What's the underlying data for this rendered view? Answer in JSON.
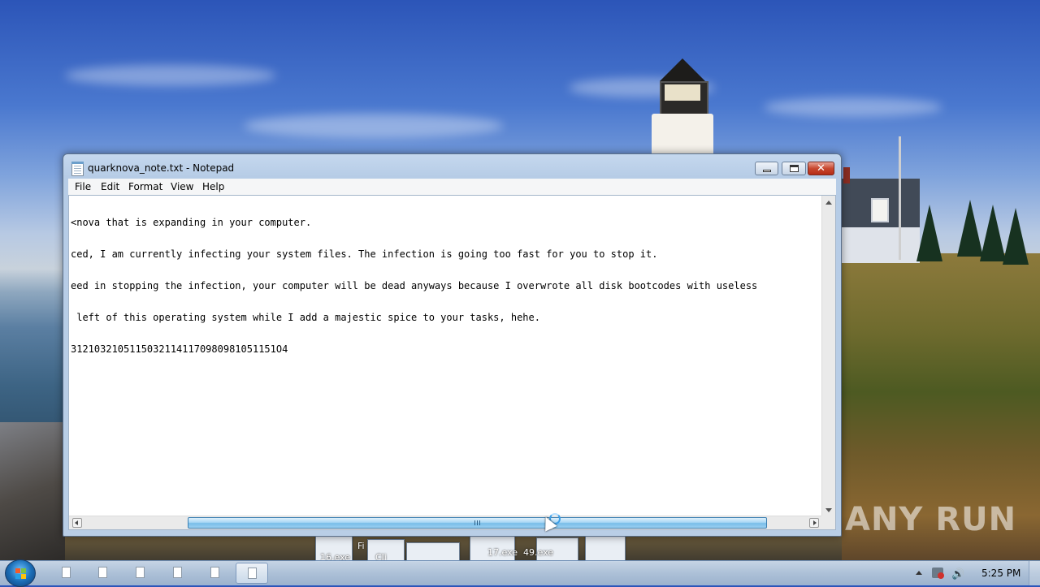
{
  "window": {
    "title": "quarknova_note.txt - Notepad",
    "close_glyph": "✕"
  },
  "menu": {
    "file": "File",
    "edit": "Edit",
    "format": "Format",
    "view": "View",
    "help": "Help"
  },
  "editor": {
    "lines": [
      "<nova that is expanding in your computer.",
      "ced, I am currently infecting your system files. The infection is going too fast for you to stop it.",
      "eed in stopping the infection, your computer will be dead anyways because I overwrote all disk bootcodes with useless",
      " left of this operating system while I add a majestic spice to your tasks, hehe.",
      "31210321051150321141170980981051151O4"
    ]
  },
  "desktop": {
    "watermark": "ANY RUN",
    "stack_labels": [
      "16.exe",
      "Cli",
      "Fi",
      "17.exe",
      "49.exe"
    ]
  },
  "taskbar": {
    "clock": "5:25 PM",
    "volume_icon": "🔊"
  },
  "icons": {
    "window": "notepad-icon",
    "start": "windows-logo-icon",
    "taskbar_items": [
      "document-icon",
      "document-icon",
      "document-icon",
      "document-icon",
      "document-icon",
      "document-icon"
    ]
  }
}
